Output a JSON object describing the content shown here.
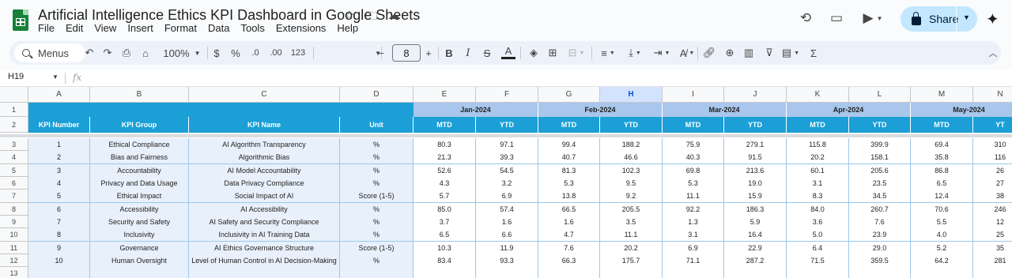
{
  "app": {
    "title": "Artificial Intelligence Ethics KPI Dashboard in Google Sheets",
    "menu": [
      "File",
      "Edit",
      "View",
      "Insert",
      "Format",
      "Data",
      "Tools",
      "Extensions",
      "Help"
    ],
    "share_label": "Share"
  },
  "toolbar": {
    "search_label": "Menus",
    "zoom": "100%",
    "currency": "$",
    "percent": "%",
    "dec_decrease": ".0",
    "dec_increase": ".00",
    "number_format": "123",
    "font_size": "8",
    "minus": "−",
    "plus": "+",
    "bold": "B",
    "italic": "I",
    "strike": "S",
    "text_color": "A",
    "sum": "Σ"
  },
  "formula_bar": {
    "cell_ref": "H19",
    "fx": "fx"
  },
  "sheet": {
    "columns": [
      "A",
      "B",
      "C",
      "D",
      "E",
      "F",
      "G",
      "H",
      "I",
      "J",
      "K",
      "L",
      "M",
      "N"
    ],
    "selected_column": "H",
    "row_numbers": [
      "1",
      "2",
      "3",
      "4",
      "5",
      "6",
      "7",
      "8",
      "9",
      "10",
      "11",
      "12",
      "13"
    ],
    "months": [
      "Jan-2024",
      "Feb-2024",
      "Mar-2024",
      "Apr-2024",
      "May-2024"
    ],
    "headers": [
      "KPI Number",
      "KPI Group",
      "KPI Name",
      "Unit",
      "MTD",
      "YTD",
      "MTD",
      "YTD",
      "MTD",
      "YTD",
      "MTD",
      "YTD",
      "MTD",
      "YT"
    ],
    "rows": [
      [
        "1",
        "Ethical Compliance",
        "AI Algorithm Transparency",
        "%",
        "80.3",
        "97.1",
        "99.4",
        "188.2",
        "75.9",
        "279.1",
        "115.8",
        "399.9",
        "69.4",
        "310"
      ],
      [
        "2",
        "Bias and Fairness",
        "Algorithmic Bias",
        "%",
        "21.3",
        "39.3",
        "40.7",
        "46.6",
        "40.3",
        "91.5",
        "20.2",
        "158.1",
        "35.8",
        "116"
      ],
      [
        "3",
        "Accountability",
        "AI Model Accountability",
        "%",
        "52.6",
        "54.5",
        "81.3",
        "102.3",
        "69.8",
        "213.6",
        "60.1",
        "205.6",
        "86.8",
        "26"
      ],
      [
        "4",
        "Privacy and Data Usage",
        "Data Privacy Compliance",
        "%",
        "4.3",
        "3.2",
        "5.3",
        "9.5",
        "5.3",
        "19.0",
        "3.1",
        "23.5",
        "6.5",
        "27"
      ],
      [
        "5",
        "Ethical Impact",
        "Social Impact of AI",
        "Score (1-5)",
        "5.7",
        "6.9",
        "13.8",
        "9.2",
        "11.1",
        "15.9",
        "8.3",
        "34.5",
        "12.4",
        "38"
      ],
      [
        "6",
        "Accessibility",
        "AI Accessibility",
        "%",
        "85.0",
        "57.4",
        "66.5",
        "205.5",
        "92.2",
        "186.3",
        "84.0",
        "260.7",
        "70.6",
        "246"
      ],
      [
        "7",
        "Security and Safety",
        "AI Safety and Security Compliance",
        "%",
        "3.7",
        "1.6",
        "1.6",
        "3.5",
        "1.3",
        "5.9",
        "3.6",
        "7.6",
        "5.5",
        "12"
      ],
      [
        "8",
        "Inclusivity",
        "Inclusivity in AI Training Data",
        "%",
        "6.5",
        "6.6",
        "4.7",
        "11.1",
        "3.1",
        "16.4",
        "5.0",
        "23.9",
        "4.0",
        "25"
      ],
      [
        "9",
        "Governance",
        "AI Ethics Governance Structure",
        "Score (1-5)",
        "10.3",
        "11.9",
        "7.6",
        "20.2",
        "6.9",
        "22.9",
        "6.4",
        "29.0",
        "5.2",
        "35"
      ],
      [
        "10",
        "Human Oversight",
        "Level of Human Control in AI Decision-Making",
        "%",
        "83.4",
        "93.3",
        "66.3",
        "175.7",
        "71.1",
        "287.2",
        "71.5",
        "359.5",
        "64.2",
        "281"
      ]
    ]
  },
  "colors": {
    "header_blue": "#1b9fd6",
    "month_band": "#a9c7ec",
    "share_bg": "#c2e7ff",
    "sheets_green": "#188038"
  }
}
